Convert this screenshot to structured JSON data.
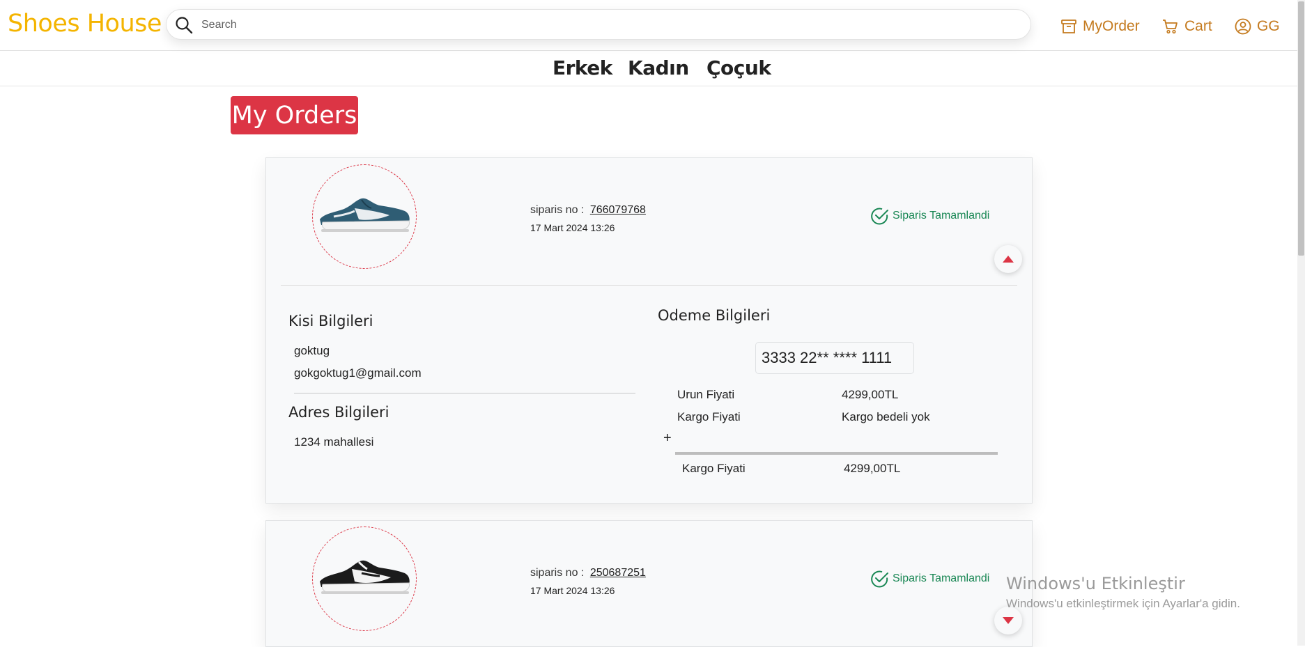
{
  "header": {
    "logo": "Shoes House",
    "search_placeholder": "Search",
    "my_order_label": "MyOrder",
    "cart_label": "Cart",
    "user_label": "GG"
  },
  "categories": [
    "Erkek",
    "Kadın",
    "Çoçuk"
  ],
  "page_title": "My Orders",
  "orders": [
    {
      "order_no_label": "siparis no :",
      "order_no": "766079768",
      "date": "17 Mart 2024 13:26",
      "status": "Siparis Tamamlandi",
      "image_icon": "teal-sneaker-icon",
      "expanded": true,
      "details": {
        "person_title": "Kisi Bilgileri",
        "name": "goktug",
        "email": "gokgoktug1@gmail.com",
        "address_title": "Adres Bilgileri",
        "address": "1234 mahallesi",
        "payment_title": "Odeme Bilgileri",
        "card_number": "3333 22** **** 1111",
        "product_price_label": "Urun Fiyati",
        "product_price": "4299,00TL",
        "shipping_label": "Kargo Fiyati",
        "shipping_value": "Kargo bedeli yok",
        "plus": "+",
        "total_label": "Kargo Fiyati",
        "total_value": "4299,00TL"
      }
    },
    {
      "order_no_label": "siparis no :",
      "order_no": "250687251",
      "date": "17 Mart 2024 13:26",
      "status": "Siparis Tamamlandi",
      "image_icon": "black-white-sneaker-icon",
      "expanded": false
    }
  ],
  "watermark": {
    "title": "Windows'u Etkinleştir",
    "subtitle": "Windows'u etkinleştirmek için Ayarlar'a gidin."
  },
  "colors": {
    "brand": "#f4b400",
    "nav": "#c47a1e",
    "accent": "#dc3545",
    "success": "#198754"
  }
}
